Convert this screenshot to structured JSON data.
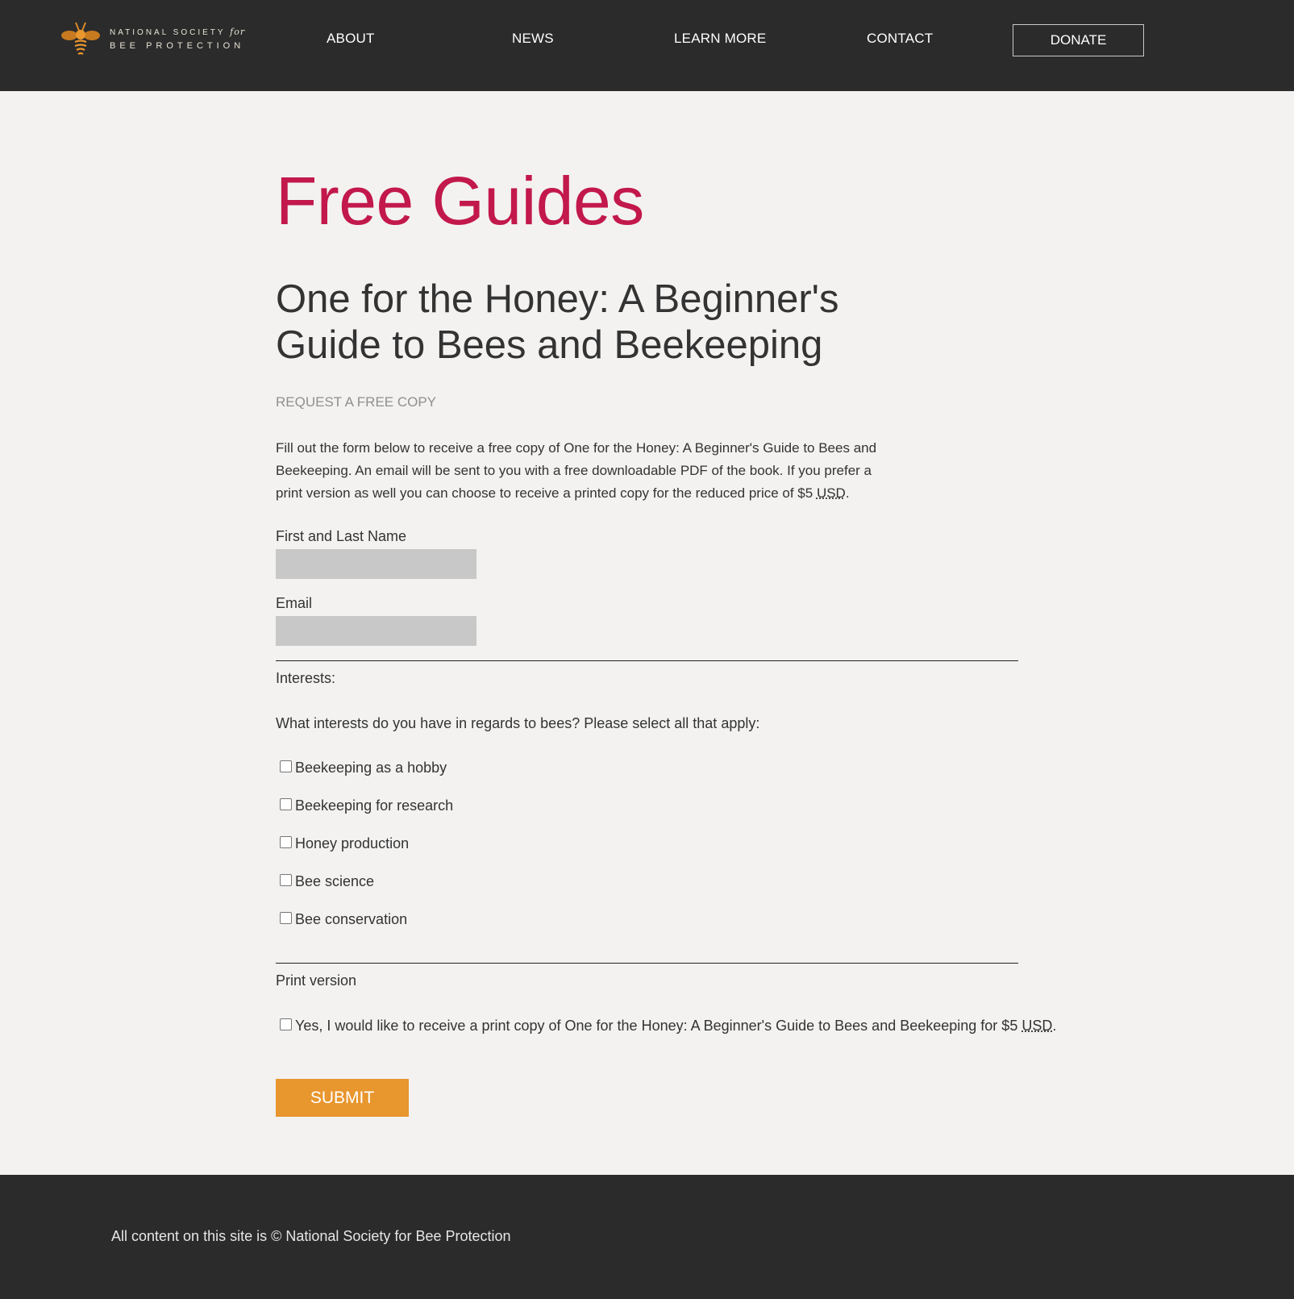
{
  "header": {
    "logo": {
      "line1": "NATIONAL SOCIETY",
      "line1_for": "for",
      "line2": "BEE PROTECTION",
      "icon": "bee-icon"
    },
    "nav": {
      "about": "ABOUT",
      "news": "NEWS",
      "learn_more": "LEARN MORE",
      "contact": "CONTACT",
      "donate": "DONATE"
    }
  },
  "main": {
    "page_title": "Free Guides",
    "guide_title": "One for the Honey: A Beginner's Guide to Bees and Beekeeping",
    "request_label": "REQUEST A FREE COPY",
    "intro": {
      "text": "Fill out the form below to receive a free copy of One for the Honey: A Beginner's Guide to Bees and Beekeeping. An email will be sent to you with a free downloadable PDF of the book. If you prefer a print version as well you can choose to receive a printed copy for the reduced price of $5 ",
      "currency": "USD",
      "end": "."
    },
    "form": {
      "name_label": "First and Last Name",
      "name_value": "",
      "email_label": "Email",
      "email_value": "",
      "interests_label": "Interests:",
      "interests_question": "What interests do you have in regards to bees? Please select all that apply:",
      "interests": [
        {
          "label": "Beekeeping as a hobby",
          "checked": false
        },
        {
          "label": "Beekeeping for research",
          "checked": false
        },
        {
          "label": "Honey production",
          "checked": false
        },
        {
          "label": "Bee science",
          "checked": false
        },
        {
          "label": "Bee conservation",
          "checked": false
        }
      ],
      "print_label": "Print version",
      "print_option": {
        "text": "Yes, I would like to receive a print copy of One for the Honey: A Beginner's Guide to Bees and Beekeeping for $5 ",
        "currency": "USD",
        "end": ".",
        "checked": false
      },
      "submit_label": "SUBMIT"
    }
  },
  "footer": {
    "text": "All content on this site is © National Society for Bee Protection"
  },
  "colors": {
    "header_bg": "#2b2b2b",
    "page_bg": "#f3f2f1",
    "title_accent": "#c2184b",
    "submit_bg": "#e8962e",
    "input_bg": "#c8c8c8"
  }
}
